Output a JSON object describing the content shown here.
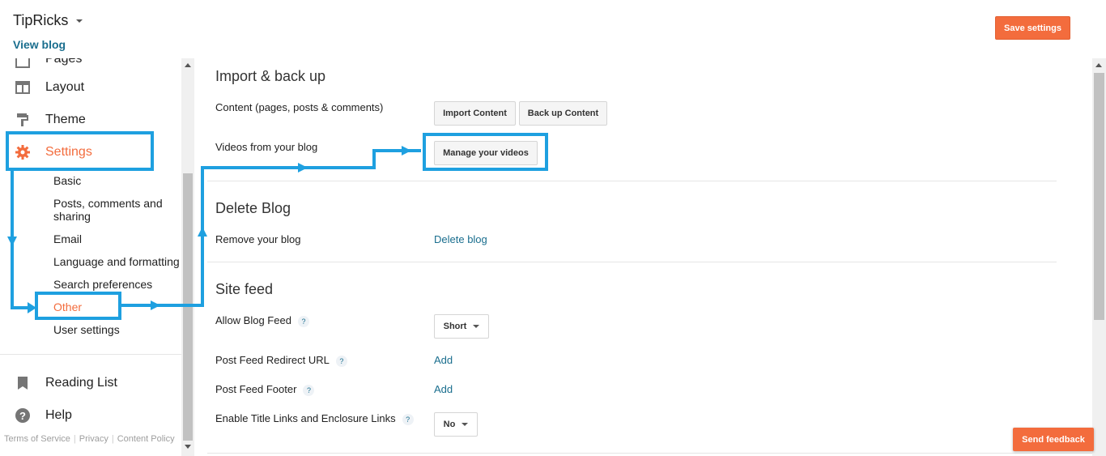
{
  "header": {
    "blog_title": "TipRicks",
    "view_blog": "View blog",
    "save_settings": "Save settings"
  },
  "sidebar": {
    "partial_item": "Pages",
    "items": [
      {
        "label": "Layout",
        "icon": "layout-icon"
      },
      {
        "label": "Theme",
        "icon": "paint-roller-icon"
      },
      {
        "label": "Settings",
        "icon": "gear-icon"
      }
    ],
    "settings_sub": [
      {
        "label": "Basic"
      },
      {
        "label": "Posts, comments and sharing"
      },
      {
        "label": "Email"
      },
      {
        "label": "Language and formatting"
      },
      {
        "label": "Search preferences"
      },
      {
        "label": "Other"
      },
      {
        "label": "User settings"
      }
    ],
    "bottom_items": [
      {
        "label": "Reading List",
        "icon": "bookmark-icon"
      },
      {
        "label": "Help",
        "icon": "help-icon"
      }
    ],
    "footer": {
      "terms": "Terms of Service",
      "privacy": "Privacy",
      "content_policy": "Content Policy"
    }
  },
  "main": {
    "import_backup": {
      "title": "Import & back up",
      "content_label": "Content (pages, posts & comments)",
      "import_btn": "Import Content",
      "backup_btn": "Back up Content",
      "videos_label": "Videos from your blog",
      "manage_videos_btn": "Manage your videos"
    },
    "delete_blog": {
      "title": "Delete Blog",
      "remove_label": "Remove your blog",
      "delete_link": "Delete blog"
    },
    "site_feed": {
      "title": "Site feed",
      "allow_feed_label": "Allow Blog Feed",
      "allow_feed_value": "Short",
      "redirect_label": "Post Feed Redirect URL",
      "redirect_link": "Add",
      "footer_label": "Post Feed Footer",
      "footer_link": "Add",
      "title_links_label": "Enable Title Links and Enclosure Links",
      "title_links_value": "No",
      "help_mark": "?"
    }
  },
  "feedback": "Send feedback",
  "colors": {
    "accent": "#f36c3d",
    "link": "#1a6e8e",
    "annotation": "#1ea0e0"
  }
}
